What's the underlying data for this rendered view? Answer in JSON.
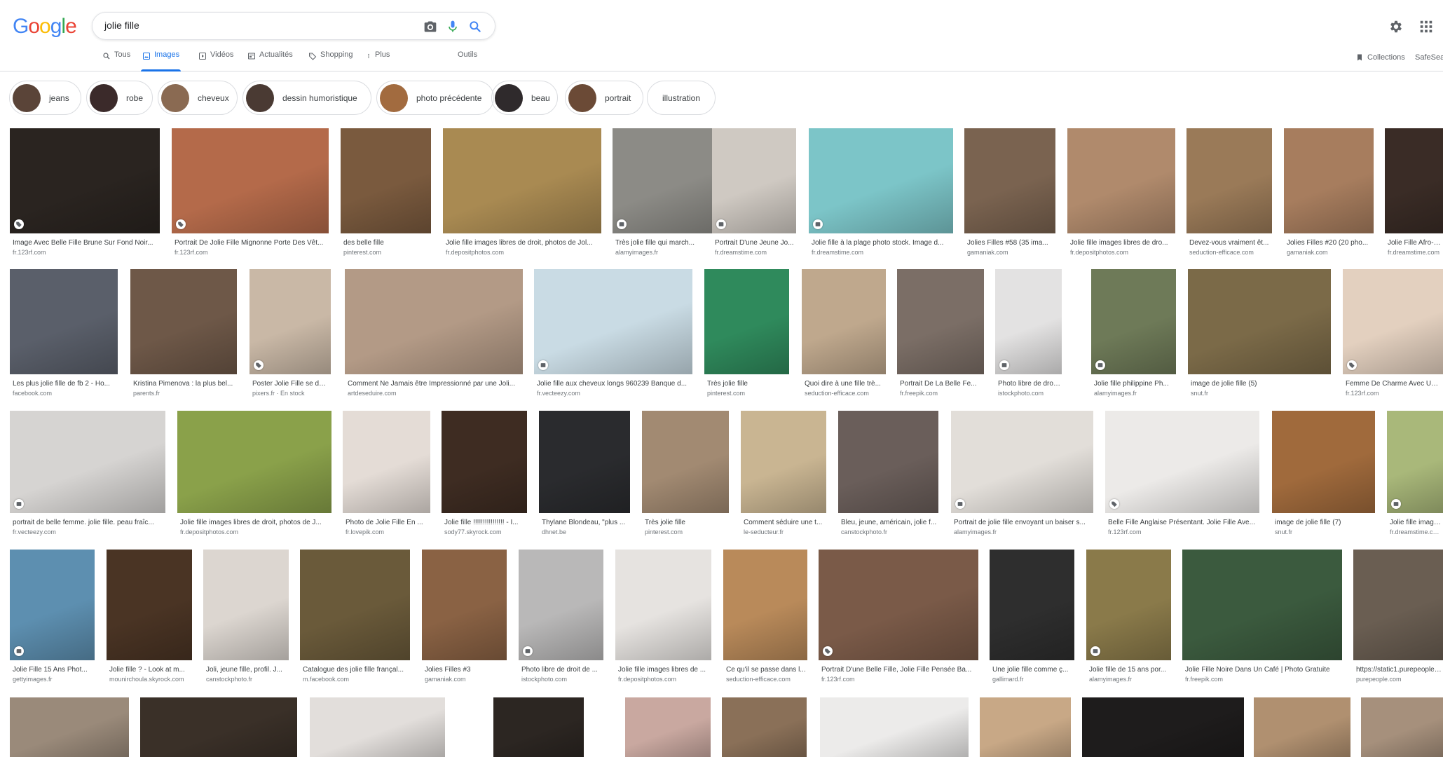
{
  "logo": {
    "letters": [
      "G",
      "o",
      "o",
      "g",
      "l",
      "e"
    ],
    "colors": [
      "#4285F4",
      "#EA4335",
      "#FBBC05",
      "#4285F4",
      "#34A853",
      "#EA4335"
    ]
  },
  "search": {
    "query": "jolie fille"
  },
  "tabs": [
    {
      "label": "Tous",
      "icon": "search-icon"
    },
    {
      "label": "Images",
      "icon": "image-icon",
      "active": true
    },
    {
      "label": "Vidéos",
      "icon": "play-icon"
    },
    {
      "label": "Actualités",
      "icon": "news-icon"
    },
    {
      "label": "Shopping",
      "icon": "tag-icon"
    },
    {
      "label": "Plus",
      "icon": "more-vert-icon"
    },
    {
      "label": "Outils",
      "icon": ""
    }
  ],
  "right": {
    "collections": "Collections",
    "safesearch": "SafeSea"
  },
  "chips": [
    {
      "label": "jeans",
      "color": "#5a4438"
    },
    {
      "label": "robe",
      "color": "#3b2a2a"
    },
    {
      "label": "cheveux",
      "color": "#8a6a52"
    },
    {
      "label": "dessin humoristique",
      "color": "#4a3a33"
    },
    {
      "label": "photo précédente",
      "color": "#a26b3f"
    },
    {
      "label": "beau",
      "color": "#2f2a2c"
    },
    {
      "label": "portrait",
      "color": "#6b4a36"
    },
    {
      "label": "illustration",
      "color": ""
    }
  ],
  "rows": [
    [
      {
        "caption": "Image Avec Belle Fille Brune Sur Fond Noir...",
        "source": "fr.123rf.com",
        "color": "#2a2420",
        "badge": "tag-icon"
      },
      {
        "caption": "Portrait De Jolie Fille Mignonne Porte Des Vêt...",
        "source": "fr.123rf.com",
        "color": "#b46a4a",
        "badge": "tag-icon"
      },
      {
        "caption": "des belle fille",
        "source": "pinterest.com",
        "color": "#7a5a3e"
      },
      {
        "caption": "Jolie fille images libres de droit, photos de Jol...",
        "source": "fr.depositphotos.com",
        "color": "#a98a52"
      },
      {
        "caption": "Très jolie fille qui march...",
        "source": "alamyimages.fr",
        "color": "#8c8b86",
        "badge": "product-icon"
      },
      {
        "caption": "Portrait D'une Jeune Jo...",
        "source": "fr.dreamstime.com",
        "color": "#cfc9c2",
        "badge": "product-icon"
      },
      {
        "caption": "Jolie fille à la plage photo stock. Image d...",
        "source": "fr.dreamstime.com",
        "color": "#7cc5c8",
        "badge": "product-icon"
      },
      {
        "caption": "Jolies Filles #58 (35 ima...",
        "source": "gamaniak.com",
        "color": "#7a6350"
      },
      {
        "caption": "Jolie fille images libres de dro...",
        "source": "fr.depositphotos.com",
        "color": "#b08a6c"
      },
      {
        "caption": "Devez-vous vraiment êt...",
        "source": "seduction-efficace.com",
        "color": "#9a7a58"
      },
      {
        "caption": "Jolies Filles #20 (20 pho...",
        "source": "gamaniak.com",
        "color": "#a77d5e"
      },
      {
        "caption": "Jolie Fille Afro-am...",
        "source": "fr.dreamstime.com",
        "color": "#3a2c26"
      }
    ],
    [
      {
        "caption": "Les plus jolie fille de fb 2 - Ho...",
        "source": "facebook.com",
        "color": "#5a5f6a"
      },
      {
        "caption": "Kristina Pimenova : la plus bel...",
        "source": "parents.fr",
        "color": "#6e5848"
      },
      {
        "caption": "Poster Jolie Fille se dés...",
        "source": "pixers.fr · En stock",
        "color": "#c9b8a6",
        "badge": "tag-icon"
      },
      {
        "caption": "Comment Ne Jamais être Impressionné par une Joli...",
        "source": "artdeseduire.com",
        "color": "#b39a86"
      },
      {
        "caption": "Jolie fille aux cheveux longs 960239 Banque d...",
        "source": "fr.vecteezy.com",
        "color": "#c9dbe4",
        "badge": "product-icon"
      },
      {
        "caption": "Très jolie fille",
        "source": "pinterest.com",
        "color": "#2f8a5c"
      },
      {
        "caption": "Quoi dire à une fille trè...",
        "source": "seduction-efficace.com",
        "color": "#bfa88d"
      },
      {
        "caption": "Portrait De La Belle Fe...",
        "source": "fr.freepik.com",
        "color": "#7b6e66"
      },
      {
        "caption": "Photo libre de droit de ...",
        "source": "istockphoto.com",
        "color": "#e3e2e2",
        "badge": "product-icon"
      },
      {
        "caption": "Jolie fille philippine Ph...",
        "source": "alamyimages.fr",
        "color": "#6e7a58",
        "badge": "product-icon"
      },
      {
        "caption": "image de jolie fille (5)",
        "source": "snut.fr",
        "color": "#7b6a48"
      },
      {
        "caption": "Femme De Charme Avec Une F...",
        "source": "fr.123rf.com",
        "color": "#e3d0bf",
        "badge": "tag-icon"
      }
    ],
    [
      {
        "caption": "portrait de belle femme. jolie fille. peau fraîc...",
        "source": "fr.vecteezy.com",
        "color": "#d6d4d2",
        "badge": "product-icon"
      },
      {
        "caption": "Jolie fille images libres de droit, photos de J...",
        "source": "fr.depositphotos.com",
        "color": "#8aa14a"
      },
      {
        "caption": "Photo de Jolie Fille En ...",
        "source": "fr.lovepik.com",
        "color": "#e4dcd6"
      },
      {
        "caption": "Jolie fille !!!!!!!!!!!!!!!! - I...",
        "source": "sody77.skyrock.com",
        "color": "#3e2c22"
      },
      {
        "caption": "Thylane Blondeau, \"plus ...",
        "source": "dhnet.be",
        "color": "#2a2b2e"
      },
      {
        "caption": "Très jolie fille",
        "source": "pinterest.com",
        "color": "#a28a72"
      },
      {
        "caption": "Comment séduire une t...",
        "source": "le-seducteur.fr",
        "color": "#c9b592"
      },
      {
        "caption": "Bleu, jeune, américain, jolie f...",
        "source": "canstockphoto.fr",
        "color": "#6a5e5a"
      },
      {
        "caption": "Portrait de jolie fille envoyant un baiser s...",
        "source": "alamyimages.fr",
        "color": "#e2ded9",
        "badge": "product-icon"
      },
      {
        "caption": "Belle Fille Anglaise Présentant. Jolie Fille Ave...",
        "source": "fr.123rf.com",
        "color": "#eceae8",
        "badge": "tag-icon"
      },
      {
        "caption": "image de jolie fille (7)",
        "source": "snut.fr",
        "color": "#a06a3c"
      },
      {
        "caption": "Jolie fille image ...",
        "source": "fr.dreamstime.com",
        "color": "#a9b87a",
        "badge": "product-icon"
      }
    ],
    [
      {
        "caption": "Jolie Fille 15 Ans Phot...",
        "source": "gettyimages.fr",
        "color": "#5d8fb0",
        "badge": "product-icon"
      },
      {
        "caption": "Jolie fille ? - Look at m...",
        "source": "mounirchoula.skyrock.com",
        "color": "#4a3424"
      },
      {
        "caption": "Joli, jeune fille, profil. J...",
        "source": "canstockphoto.fr",
        "color": "#dcd6d0"
      },
      {
        "caption": "Catalogue des jolie fille françal...",
        "source": "m.facebook.com",
        "color": "#6a5a3a"
      },
      {
        "caption": "Jolies Filles #3",
        "source": "gamaniak.com",
        "color": "#8a6244"
      },
      {
        "caption": "Photo libre de droit de ...",
        "source": "istockphoto.com",
        "color": "#b9b8b8",
        "badge": "product-icon"
      },
      {
        "caption": "Jolie fille images libres de ...",
        "source": "fr.depositphotos.com",
        "color": "#e6e3e0"
      },
      {
        "caption": "Ce qu'il se passe dans l...",
        "source": "seduction-efficace.com",
        "color": "#b98a5a"
      },
      {
        "caption": "Portrait D'une Belle Fille, Jolie Fille Pensée Ba...",
        "source": "fr.123rf.com",
        "color": "#7a5a48",
        "badge": "tag-icon"
      },
      {
        "caption": "Une jolie fille comme ç...",
        "source": "gallimard.fr",
        "color": "#2e2e2e"
      },
      {
        "caption": "Jolie fille de 15 ans por...",
        "source": "alamyimages.fr",
        "color": "#8a7a4a",
        "badge": "product-icon"
      },
      {
        "caption": "Jolie Fille Noire Dans Un Café | Photo Gratuite",
        "source": "fr.freepik.com",
        "color": "#3b5a3e"
      },
      {
        "caption": "https://static1.purepeople.c...",
        "source": "purepeople.com",
        "color": "#6a5e52"
      }
    ],
    [
      {
        "caption": "",
        "source": "",
        "color": "#9a8a7a"
      },
      {
        "caption": "",
        "source": "",
        "color": "#3a3028"
      },
      {
        "caption": "",
        "source": "",
        "color": "#e2dedb"
      },
      {
        "caption": "",
        "source": "",
        "color": "#2c2622"
      },
      {
        "caption": "",
        "source": "",
        "color": "#c9a8a0"
      },
      {
        "caption": "",
        "source": "",
        "color": "#8a7058"
      },
      {
        "caption": "",
        "source": "",
        "color": "#ecebea"
      },
      {
        "caption": "",
        "source": "",
        "color": "#c8a886"
      },
      {
        "caption": "",
        "source": "",
        "color": "#1e1c1c"
      },
      {
        "caption": "",
        "source": "",
        "color": "#b09070"
      },
      {
        "caption": "",
        "source": "",
        "color": "#a6907c"
      }
    ]
  ]
}
